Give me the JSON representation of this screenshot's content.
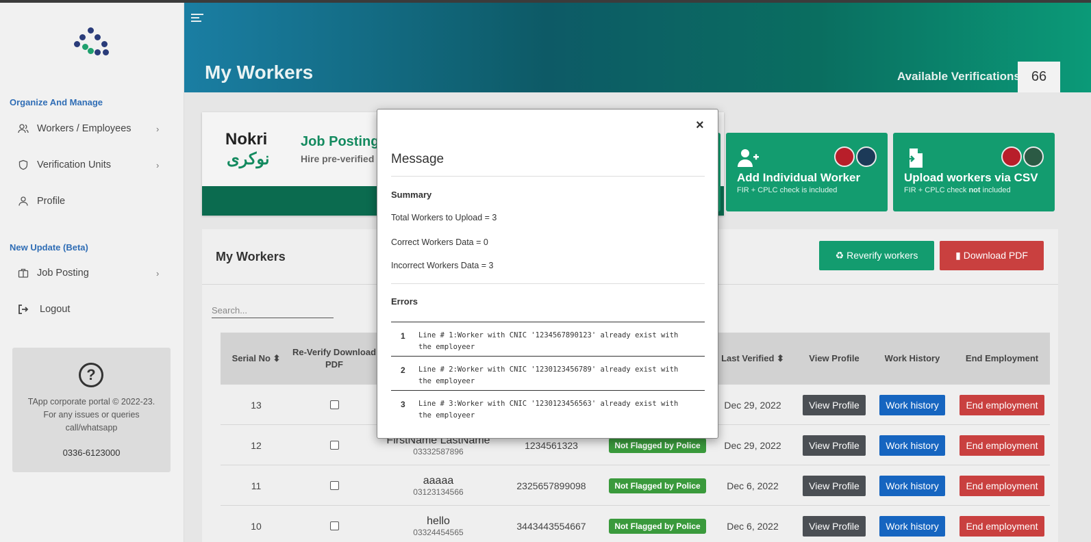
{
  "sidebar": {
    "section1": "Organize And Manage",
    "items": [
      {
        "label": "Workers / Employees"
      },
      {
        "label": "Verification Units"
      },
      {
        "label": "Profile"
      }
    ],
    "section2": "New Update (Beta)",
    "items2": [
      {
        "label": "Job Posting"
      },
      {
        "label": "Logout"
      }
    ],
    "help": {
      "text": "TApp corporate portal © 2022-23. For any issues or queries call/whatsapp",
      "phone": "0336-6123000"
    }
  },
  "header": {
    "title": "My Workers",
    "available_label": "Available Verifications",
    "available_count": "66"
  },
  "job_card": {
    "brand_en": "Nokri",
    "brand_ur": "نوکری",
    "title": "Job Posting",
    "subtitle": "Hire pre-verified"
  },
  "cards": [
    {
      "title": "Add Individual Worker",
      "subtitle": "FIR + CPLC check is included"
    },
    {
      "title": "Upload workers via CSV",
      "subtitle_pre": "FIR + CPLC check ",
      "subtitle_bold": "not",
      "subtitle_post": " included"
    }
  ],
  "workers": {
    "title": "My Workers",
    "reverify_label": "Reverify workers",
    "download_label": "Download PDF",
    "search_placeholder": "Search...",
    "columns": {
      "serial": "Serial No",
      "reverify": "Re-Verify Download PDF",
      "last_verified": "Last Verified",
      "view_profile": "View Profile",
      "work_history": "Work History",
      "end_employment": "End Employment"
    },
    "rows": [
      {
        "serial": "13",
        "name": "",
        "phone": "",
        "cnic": "",
        "status": "",
        "date": "Dec 29, 2022"
      },
      {
        "serial": "12",
        "name": "FirstName LastName",
        "phone": "03332587896",
        "cnic": "1234561323",
        "status": "Not Flagged by Police",
        "date": "Dec 29, 2022"
      },
      {
        "serial": "11",
        "name": "aaaaa",
        "phone": "03123134566",
        "cnic": "2325657899098",
        "status": "Not Flagged by Police",
        "date": "Dec 6, 2022"
      },
      {
        "serial": "10",
        "name": "hello",
        "phone": "03324454565",
        "cnic": "3443443554667",
        "status": "Not Flagged by Police",
        "date": "Dec 6, 2022"
      }
    ],
    "btn_view": "View Profile",
    "btn_history": "Work history",
    "btn_end": "End employment"
  },
  "modal": {
    "close": "×",
    "title": "Message",
    "summary_label": "Summary",
    "total": "Total Workers to Upload = 3",
    "correct": "Correct Workers Data = 0",
    "incorrect": "Incorrect Workers Data = 3",
    "errors_label": "Errors",
    "errors": [
      {
        "num": "1",
        "msg": "Line # 1:Worker with CNIC '1234567890123' already exist with the employeer"
      },
      {
        "num": "2",
        "msg": "Line # 2:Worker with CNIC '1230123456789' already exist with the employeer"
      },
      {
        "num": "3",
        "msg": "Line # 3:Worker with CNIC '1230123456563' already exist with the employeer"
      }
    ]
  },
  "colors": {
    "green": "#139c6f",
    "red": "#c9403f",
    "blue": "#1665c0",
    "badge": "#3a9a3c"
  }
}
